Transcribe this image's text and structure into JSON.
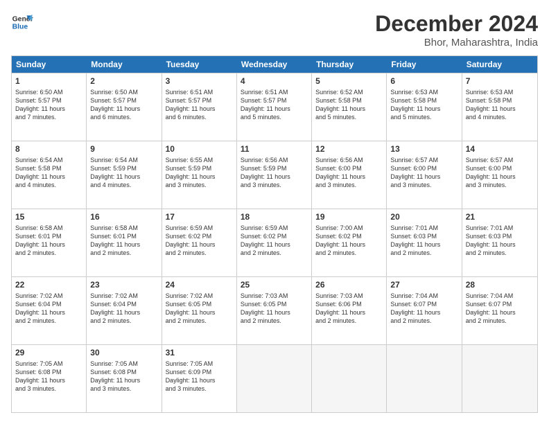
{
  "logo": {
    "line1": "General",
    "line2": "Blue"
  },
  "title": "December 2024",
  "location": "Bhor, Maharashtra, India",
  "days": [
    "Sunday",
    "Monday",
    "Tuesday",
    "Wednesday",
    "Thursday",
    "Friday",
    "Saturday"
  ],
  "rows": [
    [
      {
        "day": "1",
        "info": "Sunrise: 6:50 AM\nSunset: 5:57 PM\nDaylight: 11 hours\nand 7 minutes."
      },
      {
        "day": "2",
        "info": "Sunrise: 6:50 AM\nSunset: 5:57 PM\nDaylight: 11 hours\nand 6 minutes."
      },
      {
        "day": "3",
        "info": "Sunrise: 6:51 AM\nSunset: 5:57 PM\nDaylight: 11 hours\nand 6 minutes."
      },
      {
        "day": "4",
        "info": "Sunrise: 6:51 AM\nSunset: 5:57 PM\nDaylight: 11 hours\nand 5 minutes."
      },
      {
        "day": "5",
        "info": "Sunrise: 6:52 AM\nSunset: 5:58 PM\nDaylight: 11 hours\nand 5 minutes."
      },
      {
        "day": "6",
        "info": "Sunrise: 6:53 AM\nSunset: 5:58 PM\nDaylight: 11 hours\nand 5 minutes."
      },
      {
        "day": "7",
        "info": "Sunrise: 6:53 AM\nSunset: 5:58 PM\nDaylight: 11 hours\nand 4 minutes."
      }
    ],
    [
      {
        "day": "8",
        "info": "Sunrise: 6:54 AM\nSunset: 5:58 PM\nDaylight: 11 hours\nand 4 minutes."
      },
      {
        "day": "9",
        "info": "Sunrise: 6:54 AM\nSunset: 5:59 PM\nDaylight: 11 hours\nand 4 minutes."
      },
      {
        "day": "10",
        "info": "Sunrise: 6:55 AM\nSunset: 5:59 PM\nDaylight: 11 hours\nand 3 minutes."
      },
      {
        "day": "11",
        "info": "Sunrise: 6:56 AM\nSunset: 5:59 PM\nDaylight: 11 hours\nand 3 minutes."
      },
      {
        "day": "12",
        "info": "Sunrise: 6:56 AM\nSunset: 6:00 PM\nDaylight: 11 hours\nand 3 minutes."
      },
      {
        "day": "13",
        "info": "Sunrise: 6:57 AM\nSunset: 6:00 PM\nDaylight: 11 hours\nand 3 minutes."
      },
      {
        "day": "14",
        "info": "Sunrise: 6:57 AM\nSunset: 6:00 PM\nDaylight: 11 hours\nand 3 minutes."
      }
    ],
    [
      {
        "day": "15",
        "info": "Sunrise: 6:58 AM\nSunset: 6:01 PM\nDaylight: 11 hours\nand 2 minutes."
      },
      {
        "day": "16",
        "info": "Sunrise: 6:58 AM\nSunset: 6:01 PM\nDaylight: 11 hours\nand 2 minutes."
      },
      {
        "day": "17",
        "info": "Sunrise: 6:59 AM\nSunset: 6:02 PM\nDaylight: 11 hours\nand 2 minutes."
      },
      {
        "day": "18",
        "info": "Sunrise: 6:59 AM\nSunset: 6:02 PM\nDaylight: 11 hours\nand 2 minutes."
      },
      {
        "day": "19",
        "info": "Sunrise: 7:00 AM\nSunset: 6:02 PM\nDaylight: 11 hours\nand 2 minutes."
      },
      {
        "day": "20",
        "info": "Sunrise: 7:01 AM\nSunset: 6:03 PM\nDaylight: 11 hours\nand 2 minutes."
      },
      {
        "day": "21",
        "info": "Sunrise: 7:01 AM\nSunset: 6:03 PM\nDaylight: 11 hours\nand 2 minutes."
      }
    ],
    [
      {
        "day": "22",
        "info": "Sunrise: 7:02 AM\nSunset: 6:04 PM\nDaylight: 11 hours\nand 2 minutes."
      },
      {
        "day": "23",
        "info": "Sunrise: 7:02 AM\nSunset: 6:04 PM\nDaylight: 11 hours\nand 2 minutes."
      },
      {
        "day": "24",
        "info": "Sunrise: 7:02 AM\nSunset: 6:05 PM\nDaylight: 11 hours\nand 2 minutes."
      },
      {
        "day": "25",
        "info": "Sunrise: 7:03 AM\nSunset: 6:05 PM\nDaylight: 11 hours\nand 2 minutes."
      },
      {
        "day": "26",
        "info": "Sunrise: 7:03 AM\nSunset: 6:06 PM\nDaylight: 11 hours\nand 2 minutes."
      },
      {
        "day": "27",
        "info": "Sunrise: 7:04 AM\nSunset: 6:07 PM\nDaylight: 11 hours\nand 2 minutes."
      },
      {
        "day": "28",
        "info": "Sunrise: 7:04 AM\nSunset: 6:07 PM\nDaylight: 11 hours\nand 2 minutes."
      }
    ],
    [
      {
        "day": "29",
        "info": "Sunrise: 7:05 AM\nSunset: 6:08 PM\nDaylight: 11 hours\nand 3 minutes."
      },
      {
        "day": "30",
        "info": "Sunrise: 7:05 AM\nSunset: 6:08 PM\nDaylight: 11 hours\nand 3 minutes."
      },
      {
        "day": "31",
        "info": "Sunrise: 7:05 AM\nSunset: 6:09 PM\nDaylight: 11 hours\nand 3 minutes."
      },
      {
        "day": "",
        "info": ""
      },
      {
        "day": "",
        "info": ""
      },
      {
        "day": "",
        "info": ""
      },
      {
        "day": "",
        "info": ""
      }
    ]
  ]
}
